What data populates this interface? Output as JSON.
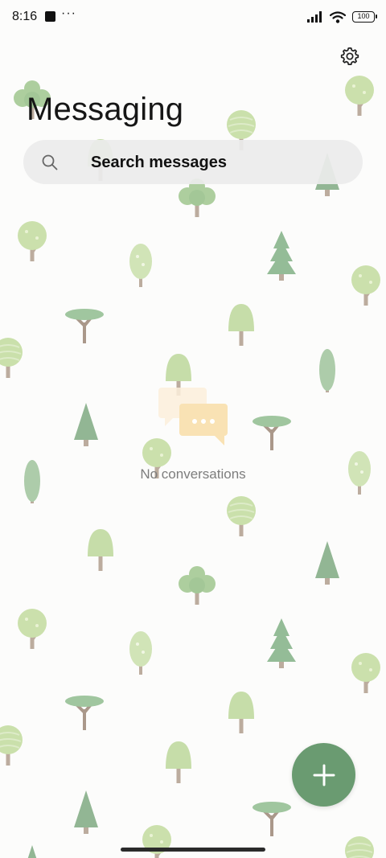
{
  "status_bar": {
    "time": "8:16",
    "more_indicator": "···",
    "battery_level": "100",
    "icons": [
      "app-notification-icon",
      "signal-icon",
      "wifi-icon",
      "battery-icon"
    ]
  },
  "header": {
    "title": "Messaging",
    "settings_icon": "gear-icon"
  },
  "search": {
    "placeholder": "Search messages",
    "icon": "search-icon"
  },
  "empty_state": {
    "message": "No conversations",
    "icon": "chat-bubbles-icon"
  },
  "fab": {
    "icon": "plus-icon",
    "color": "#6a9b71"
  },
  "theme": {
    "background": "#fcfcfb",
    "wallpaper": "forest-trees-pattern"
  }
}
